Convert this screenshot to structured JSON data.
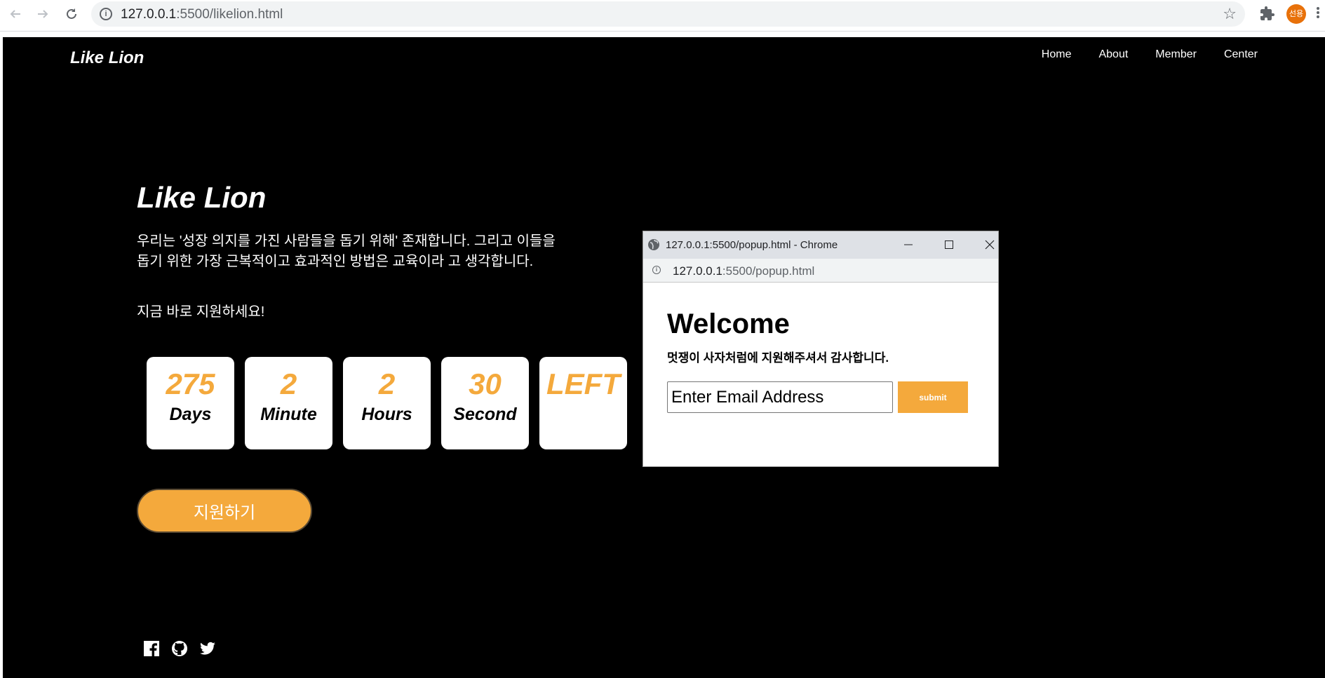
{
  "browser": {
    "url_host": "127.0.0.1",
    "url_path": ":5500/likelion.html",
    "profile_initials": "선용"
  },
  "site": {
    "logo": "Like Lion",
    "nav": [
      "Home",
      "About",
      "Member",
      "Center"
    ]
  },
  "hero": {
    "title": "Like Lion",
    "intro_line1": "우리는 '성장 의지를 가진 사람들을 돕기 위해' 존재합니다. 그리고 이들을",
    "intro_line2": "돕기 위한 가장 근복적이고 효과적인 방법은 교육이라 고 생각합니다.",
    "apply_text": "지금 바로 지원하세요!",
    "apply_button": "지원하기"
  },
  "countdown": [
    {
      "value": "275",
      "label": "Days"
    },
    {
      "value": "2",
      "label": "Minute"
    },
    {
      "value": "2",
      "label": "Hours"
    },
    {
      "value": "30",
      "label": "Second"
    },
    {
      "value": "LEFT",
      "label": ""
    }
  ],
  "popup": {
    "window_title": "127.0.0.1:5500/popup.html - Chrome",
    "url_host": "127.0.0.1",
    "url_path": ":5500/popup.html",
    "heading": "Welcome",
    "message": "멋쟁이 사자처럼에 지원해주셔서 감사합니다.",
    "email_placeholder": "Enter Email Address",
    "submit_label": "submit"
  },
  "colors": {
    "accent": "#f4a93c",
    "background": "#000000"
  },
  "social_icons": [
    "facebook-icon",
    "github-icon",
    "twitter-icon"
  ]
}
